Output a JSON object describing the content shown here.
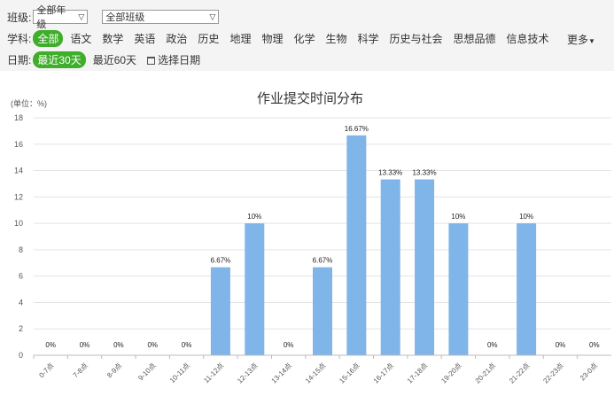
{
  "filters": {
    "class_label": "班级:",
    "grade_select": "全部年级",
    "class_select": "全部班级",
    "subject_label": "学科:",
    "subjects": [
      "全部",
      "语文",
      "数学",
      "英语",
      "政治",
      "历史",
      "地理",
      "物理",
      "化学",
      "生物",
      "科学",
      "历史与社会",
      "思想品德",
      "信息技术"
    ],
    "more": "更多",
    "date_label": "日期:",
    "date_options": [
      "最近30天",
      "最近60天"
    ],
    "pick_date": "选择日期"
  },
  "chart_data": {
    "type": "bar",
    "title": "作业提交时间分布",
    "ylabel": "(单位：%)",
    "ylim": [
      0,
      18
    ],
    "yticks": [
      0,
      2,
      4,
      6,
      8,
      10,
      12,
      14,
      16,
      18
    ],
    "grid": true,
    "bar_color": "#7fb5e8",
    "categories": [
      "0-7点",
      "7-8点",
      "8-9点",
      "9-10点",
      "10-11点",
      "11-12点",
      "12-13点",
      "13-14点",
      "14-15点",
      "15-16点",
      "16-17点",
      "17-18点",
      "19-20点",
      "20-21点",
      "21-22点",
      "22-23点",
      "23-0点"
    ],
    "values": [
      0,
      0,
      0,
      0,
      0,
      6.67,
      10,
      0,
      6.67,
      16.67,
      13.33,
      13.33,
      10,
      0,
      10,
      0,
      0
    ],
    "labels": [
      "0%",
      "0%",
      "0%",
      "0%",
      "0%",
      "6.67%",
      "10%",
      "0%",
      "6.67%",
      "16.67%",
      "13.33%",
      "13.33%",
      "10%",
      "0%",
      "10%",
      "0%",
      "0%"
    ]
  }
}
